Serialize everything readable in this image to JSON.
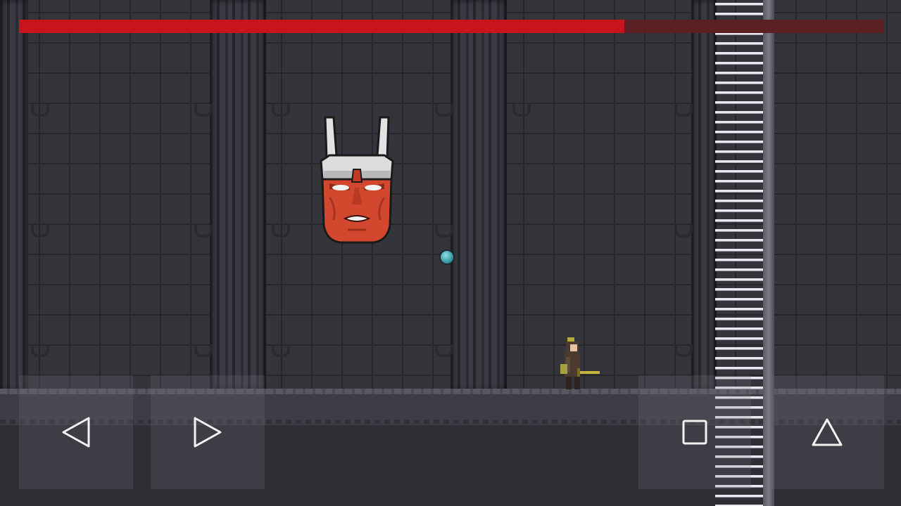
{
  "game": {
    "title": "",
    "boss": {
      "name": "",
      "health_fraction": 0.7
    },
    "colors": {
      "health_fill": "#c8141a",
      "health_empty": "#5a2024",
      "boss_face": "#d2472d",
      "boss_helmet": "#dcdcdc",
      "orb": "#3a9aa6",
      "wall": "#34343b"
    }
  },
  "controls": {
    "left_icon": "left-triangle-outline",
    "right_icon": "right-triangle-outline",
    "attack_icon": "square-outline",
    "jump_icon": "up-triangle-outline"
  }
}
